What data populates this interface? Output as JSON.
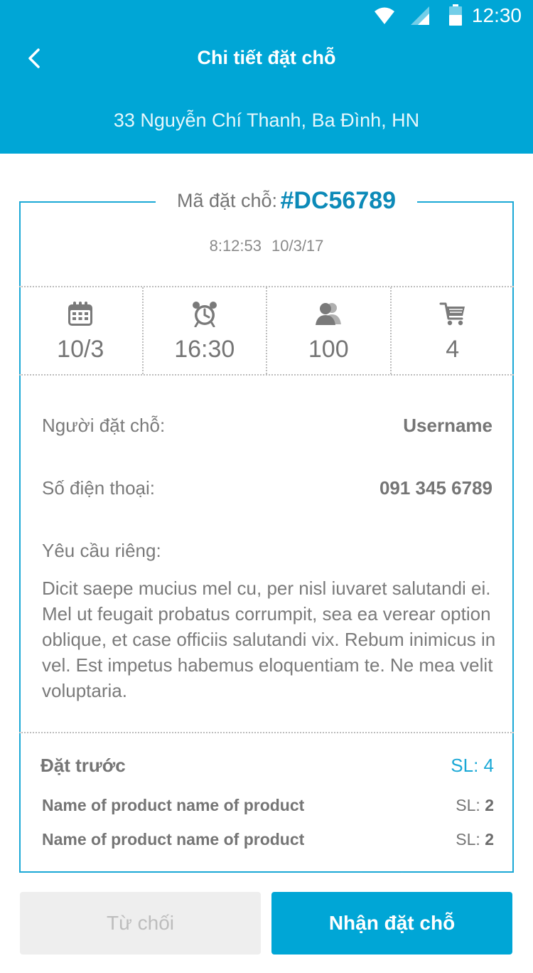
{
  "status_bar": {
    "time": "12:30"
  },
  "header": {
    "title": "Chi tiết đặt chỗ",
    "address": "33 Nguyễn Chí Thanh, Ba Đình, HN"
  },
  "booking": {
    "code_label": "Mã đặt chỗ:",
    "code": "#DC56789",
    "time": "8:12:53",
    "date": "10/3/17"
  },
  "stats": [
    {
      "icon": "calendar-icon",
      "value": "10/3"
    },
    {
      "icon": "alarm-clock-icon",
      "value": "16:30"
    },
    {
      "icon": "people-icon",
      "value": "100"
    },
    {
      "icon": "cart-icon",
      "value": "4"
    }
  ],
  "info": {
    "booker_label": "Người đặt chỗ:",
    "booker_value": "Username",
    "phone_label": "Số điện thoại:",
    "phone_value": "091 345 6789",
    "request_label": "Yêu cầu riêng:",
    "request_text": "Dicit saepe mucius mel cu, per nisl iuvaret salutandi ei. Mel ut feugait probatus corrumpit, sea ea verear option oblique, et case officiis salutandi vix. Rebum inimicus in vel. Est impetus habemus eloquentiam te. Ne mea velit voluptaria."
  },
  "preorder": {
    "title": "Đặt trước",
    "count": "SL: 4",
    "qty_prefix": "SL:",
    "items": [
      {
        "name": "Name of product name of product",
        "qty": "2"
      },
      {
        "name": "Name of product name of product",
        "qty": "2"
      }
    ]
  },
  "actions": {
    "reject": "Từ chối",
    "accept": "Nhận đặt chỗ"
  },
  "colors": {
    "primary": "#00a6d6",
    "code": "#0c8ab8",
    "text": "#757575",
    "disabled_bg": "#eeeeee"
  }
}
